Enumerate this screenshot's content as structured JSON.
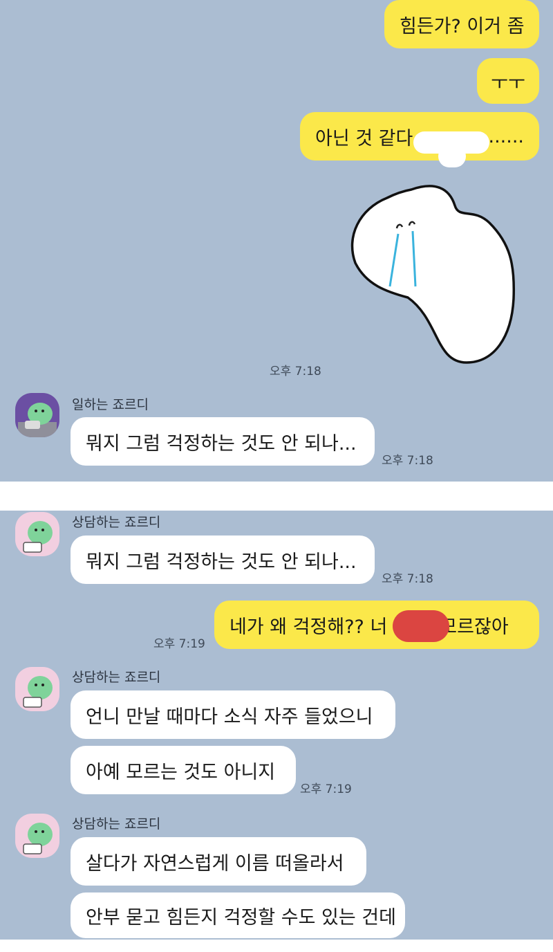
{
  "top_chat": {
    "messages": [
      {
        "text": "힘든가? 이거 좀"
      },
      {
        "text": "ㅜㅜ"
      },
      {
        "text_before": "아닌 것 같다 ",
        "text_after": "......."
      }
    ],
    "sticker_time": "오후 7:18",
    "sender_name": "일하는 죠르디",
    "reply": {
      "text": "뭐지 그럼 걱정하는 것도 안 되나...",
      "time": "오후 7:18"
    }
  },
  "bottom_chat": {
    "sender_name": "상담하는 죠르디",
    "group1": {
      "text": "뭐지 그럼 걱정하는 것도 안 되나...",
      "time": "오후 7:18"
    },
    "my_message": {
      "text_before": "네가 왜 걱정해?? 너 ",
      "text_after": " 모르잖아",
      "time": "오후 7:19"
    },
    "group2": {
      "line1": "언니 만날 때마다 소식 자주 들었으니",
      "line2": "아예 모르는 것도 아니지",
      "time": "오후 7:19"
    },
    "group3": {
      "line1": "살다가 자연스럽게 이름 떠올라서",
      "line2": "안부 묻고 힘든지 걱정할 수도 있는 건데"
    }
  },
  "colors": {
    "chat_background": "#abbdd2",
    "my_bubble": "#fbe84a",
    "their_bubble": "#ffffff",
    "redaction": "#db4541",
    "avatar_purple": "#6b4fa3",
    "avatar_pink": "#f2cfe0"
  },
  "icons": {
    "sticker": "crying-blob-sticker",
    "avatar_top": "jordy-working-avatar",
    "avatar_bottom": "jordy-counseling-avatar"
  }
}
